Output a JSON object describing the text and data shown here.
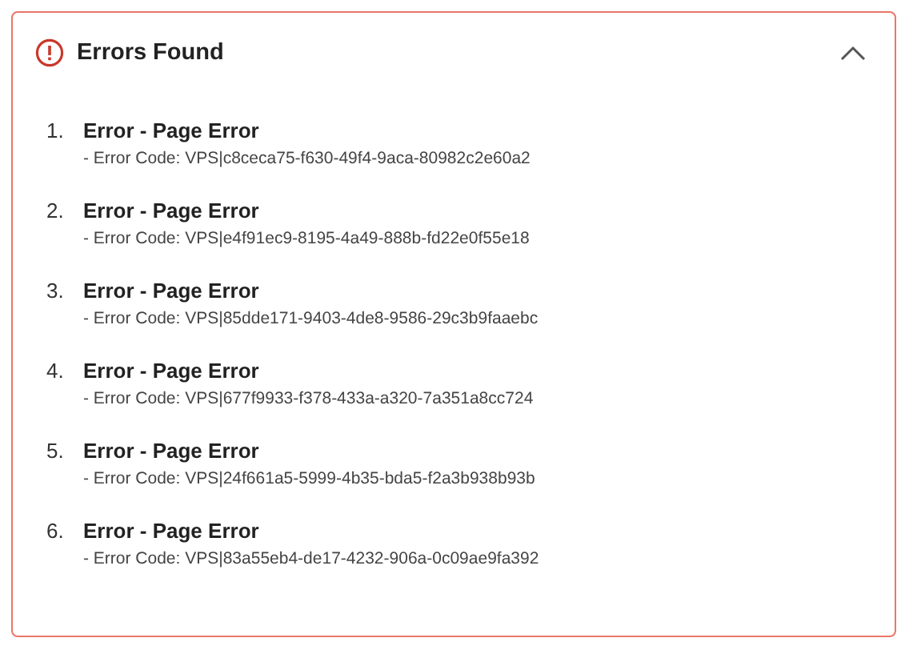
{
  "panel": {
    "title": "Errors Found",
    "expanded": true
  },
  "errors": [
    {
      "number": "1.",
      "title": "Error - Page Error",
      "code": "- Error Code: VPS|c8ceca75-f630-49f4-9aca-80982c2e60a2"
    },
    {
      "number": "2.",
      "title": "Error - Page Error",
      "code": "- Error Code: VPS|e4f91ec9-8195-4a49-888b-fd22e0f55e18"
    },
    {
      "number": "3.",
      "title": "Error - Page Error",
      "code": "- Error Code: VPS|85dde171-9403-4de8-9586-29c3b9faaebc"
    },
    {
      "number": "4.",
      "title": "Error - Page Error",
      "code": "- Error Code: VPS|677f9933-f378-433a-a320-7a351a8cc724"
    },
    {
      "number": "5.",
      "title": "Error - Page Error",
      "code": "- Error Code: VPS|24f661a5-5999-4b35-bda5-f2a3b938b93b"
    },
    {
      "number": "6.",
      "title": "Error - Page Error",
      "code": "- Error Code: VPS|83a55eb4-de17-4232-906a-0c09ae9fa392"
    }
  ]
}
